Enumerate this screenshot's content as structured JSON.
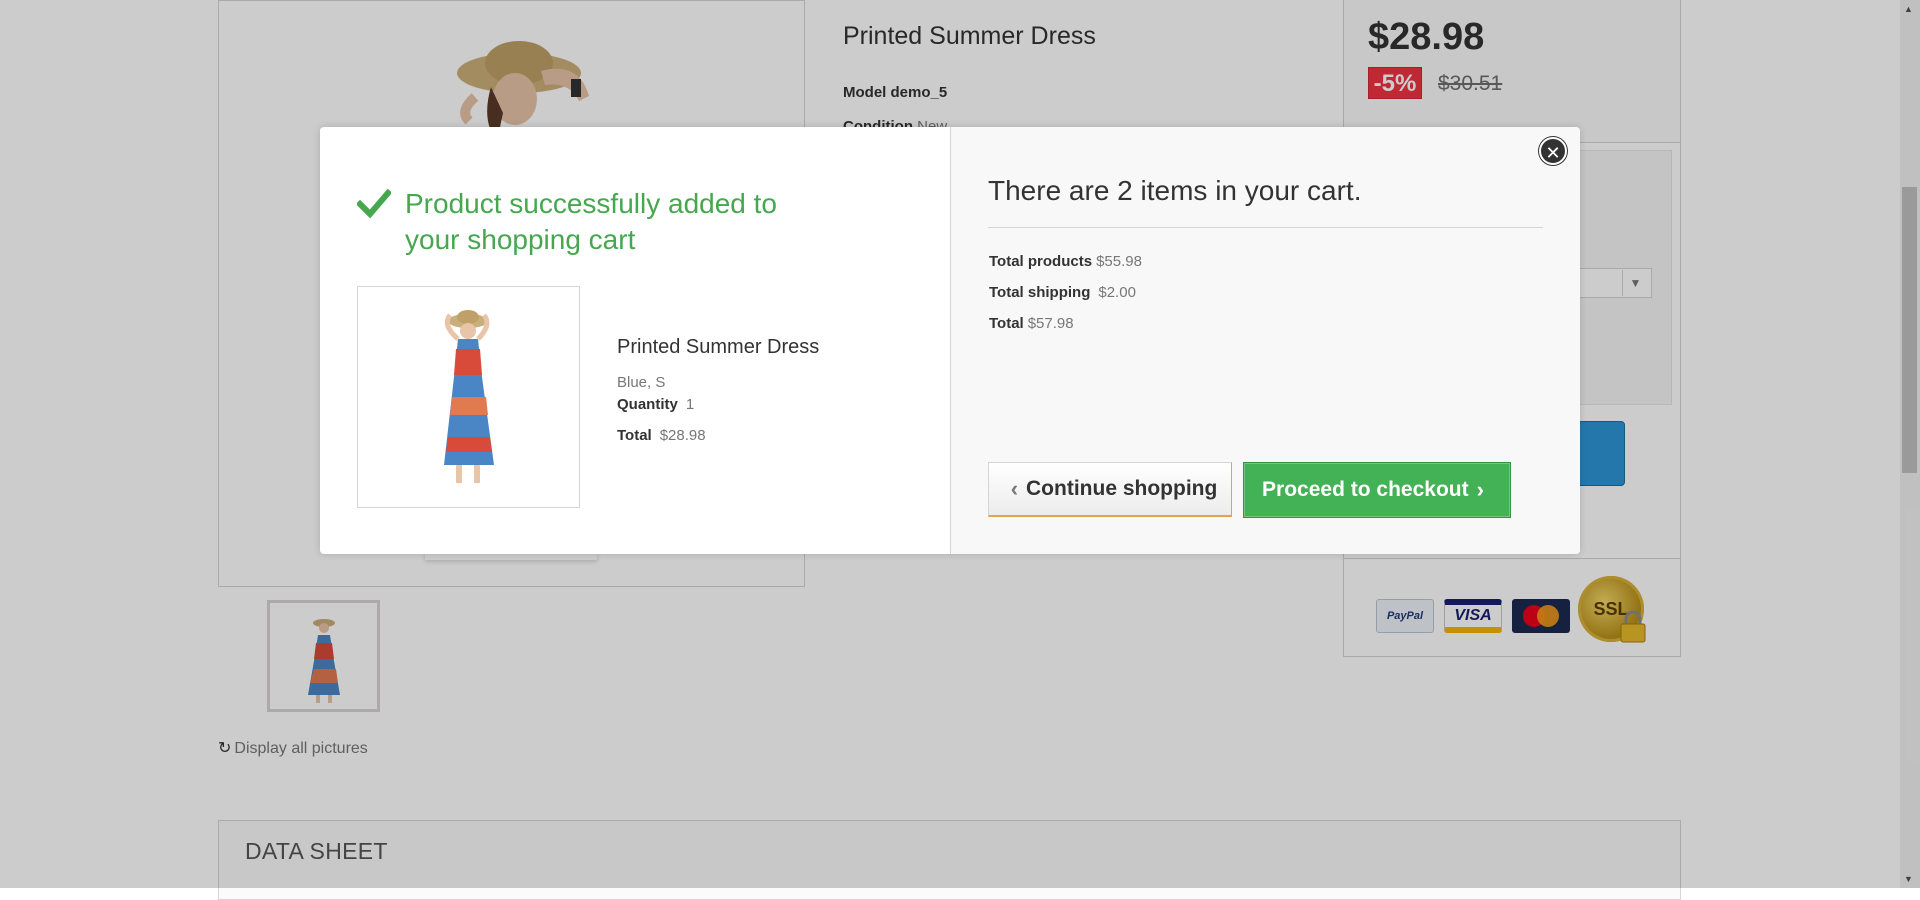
{
  "product": {
    "title": "Printed Summer Dress",
    "model_label": "Model",
    "model_value": "demo_5",
    "condition_label": "Condition",
    "condition_value": "New",
    "price": "$28.98",
    "discount": "-5%",
    "old_price": "$30.51",
    "display_all_pictures": "Display all pictures"
  },
  "payment_logos": [
    "PayPal",
    "VISA",
    "MasterCard",
    "SSL"
  ],
  "data_sheet": {
    "title": "DATA SHEET"
  },
  "modal": {
    "success_message": "Product successfully added to your shopping cart",
    "item": {
      "name": "Printed Summer Dress",
      "attributes": "Blue, S",
      "quantity_label": "Quantity",
      "quantity_value": "1",
      "total_label": "Total",
      "total_value": "$28.98"
    },
    "cart_heading": "There are 2 items in your cart.",
    "summary": {
      "total_products_label": "Total products",
      "total_products_value": "$55.98",
      "total_shipping_label": "Total shipping",
      "total_shipping_value": "$2.00",
      "total_label": "Total",
      "total_value": "$57.98"
    },
    "continue_button": "Continue shopping",
    "checkout_button": "Proceed to checkout"
  },
  "colors": {
    "success_green": "#46a74e",
    "checkout_green": "#43b155",
    "discount_red": "#f13340",
    "overlay": "rgba(0,0,0,0.2)"
  }
}
